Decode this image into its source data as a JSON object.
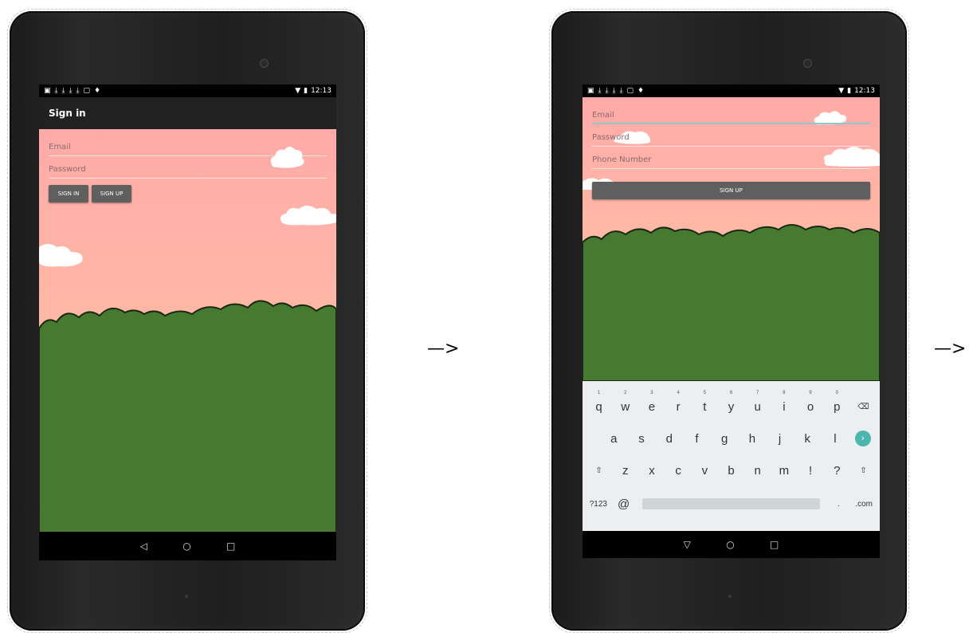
{
  "arrows": [
    "—>",
    "—>"
  ],
  "left_screen": {
    "status_time": "12:13",
    "title": "Sign in",
    "email_placeholder": "Email",
    "password_placeholder": "Password",
    "signin_label": "SIGN IN",
    "signup_label": "SIGN UP"
  },
  "right_screen": {
    "status_time": "12:13",
    "email_placeholder": "Email",
    "password_placeholder": "Password",
    "phone_placeholder": "Phone Number",
    "signup_label": "SIGN UP"
  },
  "keyboard": {
    "row1": [
      "q",
      "w",
      "e",
      "r",
      "t",
      "y",
      "u",
      "i",
      "o",
      "p"
    ],
    "row1_hints": [
      "1",
      "2",
      "3",
      "4",
      "5",
      "6",
      "7",
      "8",
      "9",
      "0"
    ],
    "row2": [
      "a",
      "s",
      "d",
      "f",
      "g",
      "h",
      "j",
      "k",
      "l"
    ],
    "row3": [
      "z",
      "x",
      "c",
      "v",
      "b",
      "n",
      "m",
      "!",
      "?"
    ],
    "row4_left": "?123",
    "row4_at": "@",
    "row4_period": ".",
    "row4_com": ".com"
  },
  "colors": {
    "sky_top": "#ffaaa9",
    "sky_bottom": "#ffcfa6",
    "grass": "#477a31",
    "button": "#5f5f5f",
    "accent_teal": "#4db6ac"
  }
}
